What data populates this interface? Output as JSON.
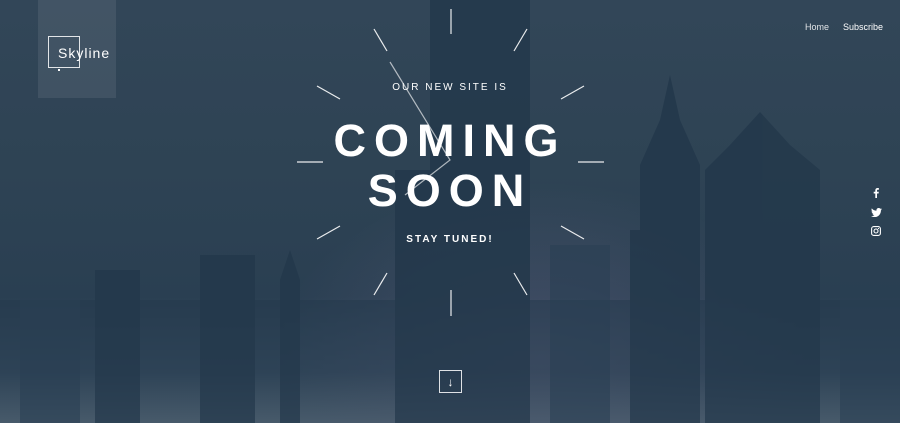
{
  "brand": {
    "name": "Skyline"
  },
  "nav": {
    "items": [
      "Home",
      "Subscribe"
    ]
  },
  "hero": {
    "eyebrow": "OUR NEW SITE IS",
    "title_line1": "COMING",
    "title_line2": "SOON",
    "tagline": "STAY TUNED!"
  },
  "social": {
    "icons": [
      "facebook-icon",
      "twitter-icon",
      "instagram-icon"
    ]
  },
  "scroll": {
    "icon": "arrow-down-icon",
    "glyph": "↓"
  },
  "colors": {
    "background": "#2b3e4e",
    "text": "#ffffff"
  }
}
